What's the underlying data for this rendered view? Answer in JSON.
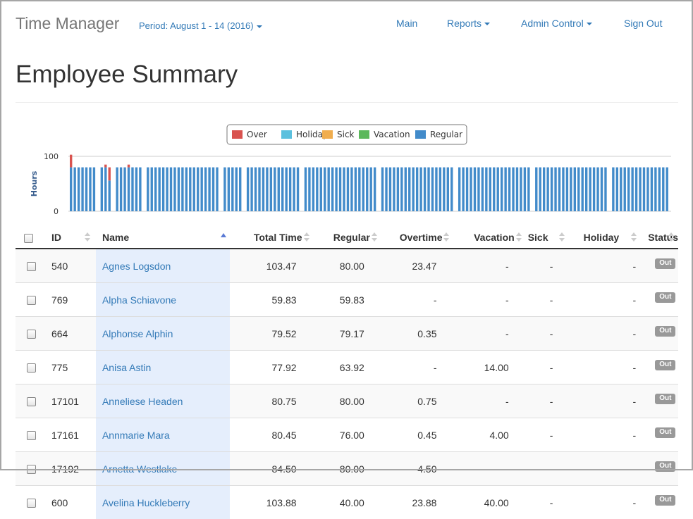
{
  "navbar": {
    "brand": "Time Manager",
    "period": "Period: August 1 - 14 (2016)",
    "items": [
      {
        "label": "Main",
        "dropdown": false
      },
      {
        "label": "Reports",
        "dropdown": true
      },
      {
        "label": "Admin Control",
        "dropdown": true
      },
      {
        "label": "Sign Out",
        "dropdown": false
      }
    ]
  },
  "page_title": "Employee Summary",
  "chart_data": {
    "type": "bar",
    "stacked": true,
    "legend": [
      "Over",
      "Holiday",
      "Sick",
      "Vacation",
      "Regular"
    ],
    "legend_position": "top-center",
    "colors": {
      "Over": "#d9534f",
      "Holiday": "#5bc0de",
      "Sick": "#f0ad4e",
      "Vacation": "#5cb85c",
      "Regular": "#428bca"
    },
    "ylabel": "Hours",
    "yticks": [
      0,
      100
    ],
    "ylim": [
      0,
      100
    ],
    "grid": true,
    "bars": [
      [
        80,
        23
      ],
      [
        80,
        0
      ],
      [
        80,
        0
      ],
      [
        80,
        0
      ],
      [
        80,
        0
      ],
      [
        80,
        0
      ],
      [
        80,
        0
      ],
      [
        0,
        0
      ],
      [
        80,
        0
      ],
      [
        80,
        5
      ],
      [
        56,
        24
      ],
      [
        0,
        0
      ],
      [
        80,
        0
      ],
      [
        80,
        0
      ],
      [
        80,
        0
      ],
      [
        80,
        5
      ],
      [
        80,
        0
      ],
      [
        80,
        0
      ],
      [
        80,
        0
      ],
      [
        0,
        0
      ],
      [
        80,
        0
      ],
      [
        80,
        0
      ],
      [
        80,
        0
      ],
      [
        80,
        0
      ],
      [
        80,
        0
      ],
      [
        80,
        0
      ],
      [
        80,
        0
      ],
      [
        80,
        0
      ],
      [
        80,
        0
      ],
      [
        80,
        0
      ],
      [
        80,
        0
      ],
      [
        80,
        0
      ],
      [
        80,
        0
      ],
      [
        80,
        0
      ],
      [
        80,
        0
      ],
      [
        80,
        0
      ],
      [
        80,
        0
      ],
      [
        80,
        0
      ],
      [
        80,
        0
      ],
      [
        0,
        0
      ],
      [
        80,
        0
      ],
      [
        80,
        0
      ],
      [
        80,
        0
      ],
      [
        80,
        0
      ],
      [
        80,
        0
      ],
      [
        0,
        0
      ],
      [
        80,
        0
      ],
      [
        80,
        0
      ],
      [
        80,
        0
      ],
      [
        80,
        0
      ],
      [
        80,
        0
      ],
      [
        80,
        0
      ],
      [
        80,
        0
      ],
      [
        80,
        0
      ],
      [
        80,
        0
      ],
      [
        80,
        0
      ],
      [
        80,
        0
      ],
      [
        80,
        0
      ],
      [
        80,
        0
      ],
      [
        80,
        0
      ],
      [
        0,
        0
      ],
      [
        80,
        0
      ],
      [
        80,
        0
      ],
      [
        80,
        0
      ],
      [
        80,
        0
      ],
      [
        80,
        0
      ],
      [
        80,
        0
      ],
      [
        80,
        0
      ],
      [
        80,
        0
      ],
      [
        80,
        0
      ],
      [
        80,
        0
      ],
      [
        80,
        0
      ],
      [
        80,
        0
      ],
      [
        80,
        0
      ],
      [
        80,
        0
      ],
      [
        80,
        0
      ],
      [
        80,
        0
      ],
      [
        80,
        0
      ],
      [
        80,
        0
      ],
      [
        80,
        0
      ],
      [
        0,
        0
      ],
      [
        80,
        0
      ],
      [
        80,
        0
      ],
      [
        80,
        0
      ],
      [
        80,
        0
      ],
      [
        80,
        0
      ],
      [
        80,
        0
      ],
      [
        80,
        0
      ],
      [
        80,
        0
      ],
      [
        80,
        0
      ],
      [
        80,
        0
      ],
      [
        80,
        0
      ],
      [
        80,
        0
      ],
      [
        80,
        0
      ],
      [
        80,
        0
      ],
      [
        80,
        0
      ],
      [
        80,
        0
      ],
      [
        80,
        0
      ],
      [
        80,
        0
      ],
      [
        80,
        0
      ],
      [
        0,
        0
      ],
      [
        80,
        0
      ],
      [
        80,
        0
      ],
      [
        80,
        0
      ],
      [
        80,
        0
      ],
      [
        80,
        0
      ],
      [
        80,
        0
      ],
      [
        80,
        0
      ],
      [
        80,
        0
      ],
      [
        80,
        0
      ],
      [
        80,
        0
      ],
      [
        80,
        0
      ],
      [
        80,
        0
      ],
      [
        80,
        0
      ],
      [
        80,
        0
      ],
      [
        80,
        0
      ],
      [
        80,
        0
      ],
      [
        80,
        0
      ],
      [
        80,
        0
      ],
      [
        80,
        0
      ],
      [
        0,
        0
      ],
      [
        80,
        0
      ],
      [
        80,
        0
      ],
      [
        80,
        0
      ],
      [
        80,
        0
      ],
      [
        80,
        0
      ],
      [
        80,
        0
      ],
      [
        80,
        0
      ],
      [
        80,
        0
      ],
      [
        80,
        0
      ],
      [
        80,
        0
      ],
      [
        80,
        0
      ],
      [
        80,
        0
      ],
      [
        80,
        0
      ],
      [
        80,
        0
      ],
      [
        80,
        0
      ],
      [
        80,
        0
      ],
      [
        80,
        0
      ],
      [
        80,
        0
      ],
      [
        80,
        0
      ],
      [
        0,
        0
      ],
      [
        80,
        0
      ],
      [
        80,
        0
      ],
      [
        80,
        0
      ],
      [
        80,
        0
      ],
      [
        80,
        0
      ],
      [
        80,
        0
      ],
      [
        80,
        0
      ],
      [
        80,
        0
      ],
      [
        80,
        0
      ],
      [
        80,
        0
      ],
      [
        80,
        0
      ],
      [
        80,
        0
      ],
      [
        80,
        0
      ],
      [
        80,
        0
      ],
      [
        80,
        0
      ]
    ]
  },
  "table": {
    "columns": [
      {
        "label": "",
        "type": "checkbox"
      },
      {
        "label": "ID"
      },
      {
        "label": "Name",
        "sorted": "asc"
      },
      {
        "label": "Total Time",
        "numeric": true
      },
      {
        "label": "Regular",
        "numeric": true
      },
      {
        "label": "Overtime",
        "numeric": true
      },
      {
        "label": "Vacation",
        "numeric": true
      },
      {
        "label": "Sick",
        "numeric": true
      },
      {
        "label": "Holiday",
        "numeric": true
      },
      {
        "label": "Status"
      }
    ],
    "rows": [
      {
        "id": "540",
        "name": "Agnes Logsdon",
        "total": "103.47",
        "regular": "80.00",
        "overtime": "23.47",
        "vacation": "-",
        "sick": "-",
        "holiday": "-",
        "status": "Out"
      },
      {
        "id": "769",
        "name": "Alpha Schiavone",
        "total": "59.83",
        "regular": "59.83",
        "overtime": "-",
        "vacation": "-",
        "sick": "-",
        "holiday": "-",
        "status": "Out"
      },
      {
        "id": "664",
        "name": "Alphonse Alphin",
        "total": "79.52",
        "regular": "79.17",
        "overtime": "0.35",
        "vacation": "-",
        "sick": "-",
        "holiday": "-",
        "status": "Out"
      },
      {
        "id": "775",
        "name": "Anisa Astin",
        "total": "77.92",
        "regular": "63.92",
        "overtime": "-",
        "vacation": "14.00",
        "sick": "-",
        "holiday": "-",
        "status": "Out"
      },
      {
        "id": "17101",
        "name": "Anneliese Headen",
        "total": "80.75",
        "regular": "80.00",
        "overtime": "0.75",
        "vacation": "-",
        "sick": "-",
        "holiday": "-",
        "status": "Out"
      },
      {
        "id": "17161",
        "name": "Annmarie Mara",
        "total": "80.45",
        "regular": "76.00",
        "overtime": "0.45",
        "vacation": "4.00",
        "sick": "-",
        "holiday": "-",
        "status": "Out"
      },
      {
        "id": "17192",
        "name": "Arnetta Westlake",
        "total": "84.50",
        "regular": "80.00",
        "overtime": "4.50",
        "vacation": "-",
        "sick": "-",
        "holiday": "-",
        "status": "Out"
      },
      {
        "id": "600",
        "name": "Avelina Huckleberry",
        "total": "103.88",
        "regular": "40.00",
        "overtime": "23.88",
        "vacation": "40.00",
        "sick": "-",
        "holiday": "-",
        "status": "Out"
      }
    ]
  }
}
